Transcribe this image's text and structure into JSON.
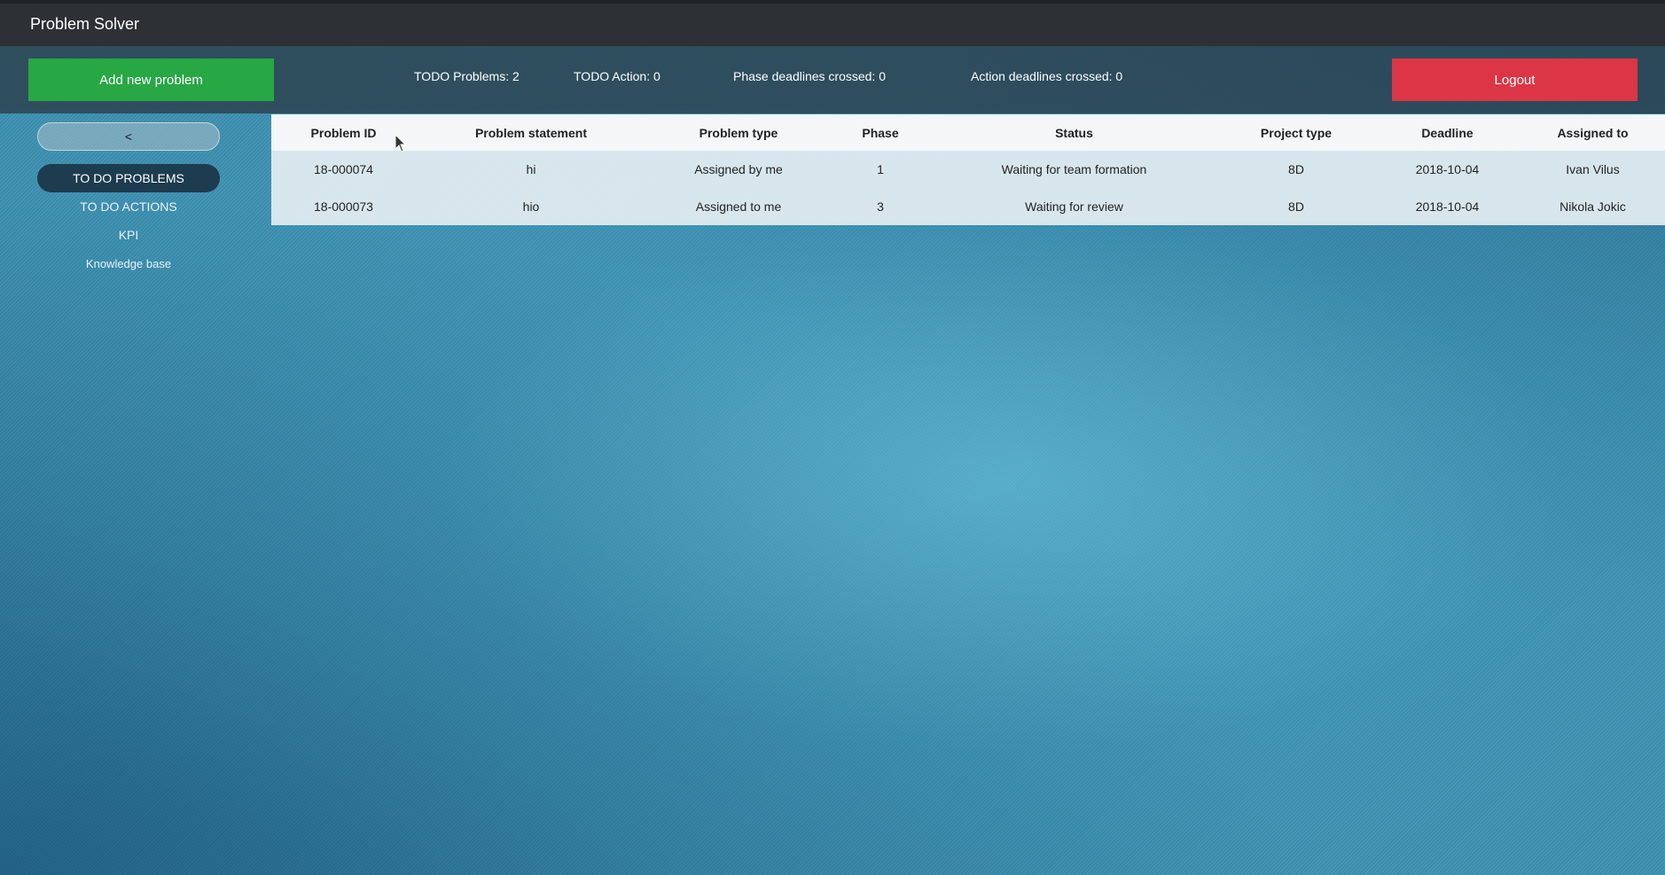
{
  "app": {
    "title": "Problem Solver"
  },
  "toolbar": {
    "add_label": "Add new problem",
    "logout_label": "Logout",
    "stats": {
      "todo_problems": "TODO Problems: 2",
      "todo_action": "TODO Action: 0",
      "phase_deadlines": "Phase deadlines crossed: 0",
      "action_deadlines": "Action deadlines crossed: 0"
    }
  },
  "sidebar": {
    "collapse_label": "<",
    "items": [
      {
        "label": "TO DO PROBLEMS",
        "active": true
      },
      {
        "label": "TO DO ACTIONS",
        "active": false
      },
      {
        "label": "KPI",
        "active": false
      },
      {
        "label": "Knowledge base",
        "active": false
      }
    ]
  },
  "table": {
    "columns": [
      "Problem ID",
      "Problem statement",
      "Problem type",
      "Phase",
      "Status",
      "Project type",
      "Deadline",
      "Assigned to"
    ],
    "rows": [
      [
        "18-000074",
        "hi",
        "Assigned by me",
        "1",
        "Waiting for team formation",
        "8D",
        "2018-10-04",
        "Ivan Vilus"
      ],
      [
        "18-000073",
        "hio",
        "Assigned to me",
        "3",
        "Waiting for review",
        "8D",
        "2018-10-04",
        "Nikola Jokic"
      ]
    ]
  },
  "colors": {
    "add_button": "#28a745",
    "logout_button": "#dc3545",
    "topbar": "#2d3035",
    "nav_active": "#1d3c4f"
  }
}
